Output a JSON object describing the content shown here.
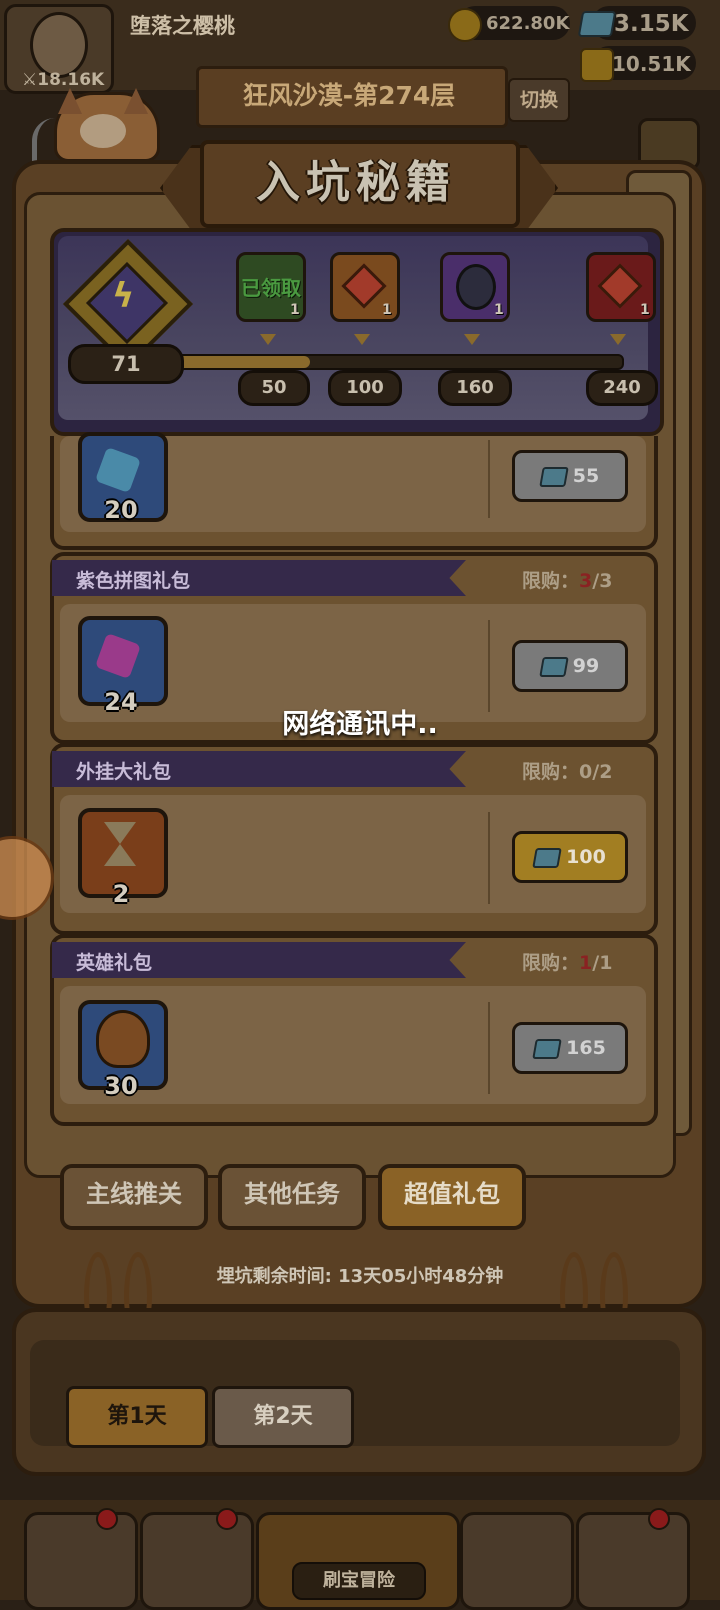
{
  "hud": {
    "player_name": "堕落之樱桃",
    "power": "18.16K",
    "gold": "622.80K",
    "gems": "3.15K",
    "tickets": "10.51K",
    "floor": "狂风沙漠-第274层",
    "switch_label": "切换"
  },
  "title": "入坑秘籍",
  "progress": {
    "score": "71",
    "fill_fraction": 0.3,
    "milestones": [
      {
        "threshold": "50",
        "status": "已领取",
        "count": "1"
      },
      {
        "threshold": "100",
        "count": "1"
      },
      {
        "threshold": "160",
        "count": "1"
      },
      {
        "threshold": "240",
        "count": "1"
      }
    ]
  },
  "packs": [
    {
      "name": "",
      "limit_label": "",
      "limit_current": "",
      "limit_total": "",
      "item_count": "20",
      "price": "55"
    },
    {
      "name": "紫色拼图礼包",
      "limit_label": "限购：",
      "limit_current": "3",
      "limit_total": "/3",
      "item_count": "24",
      "price": "99"
    },
    {
      "name": "外挂大礼包",
      "limit_label": "限购：",
      "limit_current": "0",
      "limit_total": "/2",
      "item_count": "2",
      "price": "100"
    },
    {
      "name": "英雄礼包",
      "limit_label": "限购：",
      "limit_current": "1",
      "limit_total": "/1",
      "item_count": "30",
      "price": "165"
    }
  ],
  "network_message": "网络通讯中..",
  "tabs": [
    "主线推关",
    "其他任务",
    "超值礼包"
  ],
  "timer": "埋坑剩余时间: 13天05小时48分钟",
  "days": [
    "第1天",
    "第2天"
  ],
  "nav": {
    "active_label": "刷宝冒险"
  }
}
